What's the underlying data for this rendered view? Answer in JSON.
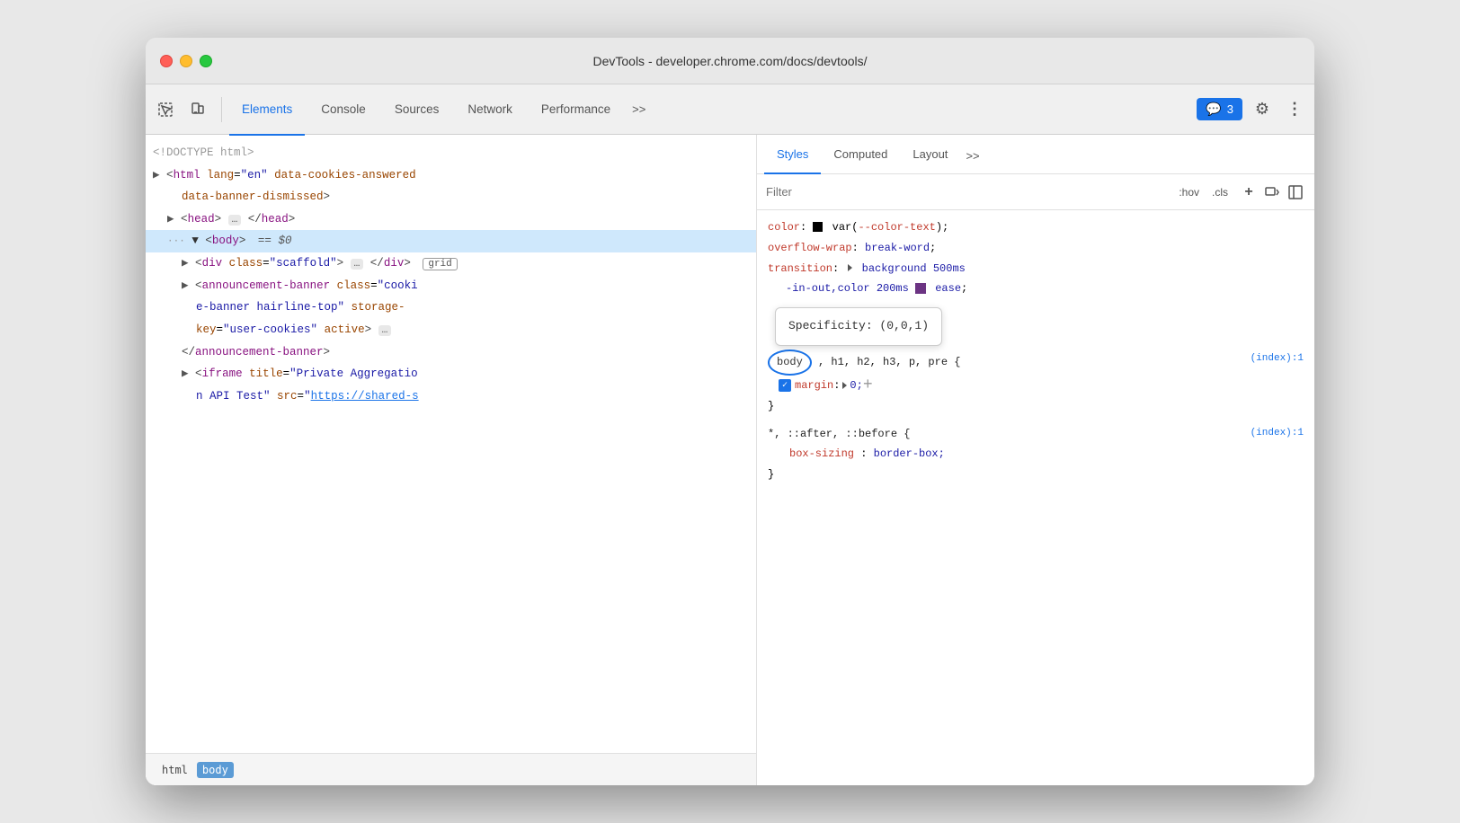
{
  "window": {
    "title": "DevTools - developer.chrome.com/docs/devtools/"
  },
  "toolbar": {
    "tabs": [
      {
        "id": "elements",
        "label": "Elements",
        "active": true
      },
      {
        "id": "console",
        "label": "Console",
        "active": false
      },
      {
        "id": "sources",
        "label": "Sources",
        "active": false
      },
      {
        "id": "network",
        "label": "Network",
        "active": false
      },
      {
        "id": "performance",
        "label": "Performance",
        "active": false
      }
    ],
    "more_label": ">>",
    "badge_count": "3",
    "settings_label": "⚙",
    "more_options_label": "⋮"
  },
  "elements_panel": {
    "lines": [
      {
        "id": "doctype",
        "text": "<!DOCTYPE html>",
        "indent": 0
      },
      {
        "id": "html-open",
        "text": "<html lang=\"en\" data-cookies-answered",
        "indent": 0
      },
      {
        "id": "html-cont",
        "text": "data-banner-dismissed>",
        "indent": 0
      },
      {
        "id": "head",
        "text": "<head>…</head>",
        "indent": 1
      },
      {
        "id": "body",
        "text": "<body> == $0",
        "indent": 1,
        "selected": true
      },
      {
        "id": "div-scaffold",
        "text": "<div class=\"scaffold\">…</div>",
        "indent": 2
      },
      {
        "id": "grid-badge",
        "text": "grid",
        "is_badge": true
      },
      {
        "id": "announcement",
        "text": "<announcement-banner class=\"cooki",
        "indent": 2
      },
      {
        "id": "announcement2",
        "text": "e-banner hairline-top\" storage-",
        "indent": 2
      },
      {
        "id": "announcement3",
        "text": "key=\"user-cookies\" active>…",
        "indent": 2
      },
      {
        "id": "announcement4",
        "text": "</announcement-banner>",
        "indent": 2
      },
      {
        "id": "iframe",
        "text": "<iframe title=\"Private Aggregatio",
        "indent": 2
      },
      {
        "id": "iframe2",
        "text": "n API Test\" src=\"https://shared-s",
        "indent": 2
      }
    ],
    "breadcrumb": {
      "items": [
        "html",
        "body"
      ]
    }
  },
  "styles_panel": {
    "tabs": [
      {
        "id": "styles",
        "label": "Styles",
        "active": true
      },
      {
        "id": "computed",
        "label": "Computed",
        "active": false
      },
      {
        "id": "layout",
        "label": "Layout",
        "active": false
      }
    ],
    "filter_placeholder": "Filter",
    "pseudo_hov": ":hov",
    "pseudo_cls": ".cls",
    "css_blocks": [
      {
        "id": "block1",
        "props": [
          {
            "name": "color",
            "value": "var(--color-text)",
            "has_swatch": true,
            "swatch_color": "#000"
          },
          {
            "name": "overflow-wrap",
            "value": "break-word"
          },
          {
            "name": "transition",
            "value": "▶ background 500ms"
          },
          {
            "name": "transition2",
            "value": "-in-out,color 200ms ✓ ease"
          }
        ]
      },
      {
        "id": "block2",
        "selector": "body, h1, h2, h3, p, pre {",
        "filename": "(index):1",
        "props": [
          {
            "name": "margin",
            "value": "▶ 0;",
            "checked": true
          }
        ]
      },
      {
        "id": "block3",
        "selector": "*, ::after, ::before {",
        "filename": "(index):1",
        "props": [
          {
            "name": "box-sizing",
            "value": "border-box;"
          }
        ]
      }
    ],
    "specificity_tooltip": "Specificity: (0,0,1)"
  }
}
